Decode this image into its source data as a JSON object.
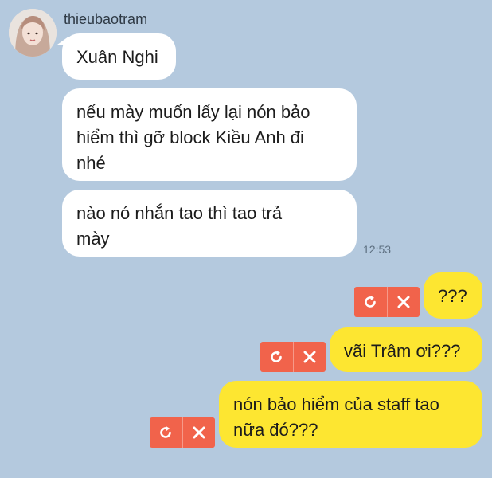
{
  "chat": {
    "sender_name": "thieubaotram",
    "incoming": [
      {
        "text": "Xuân Nghi"
      },
      {
        "text": "nếu mày muốn lấy lại nón bảo\nhiểm thì gỡ block Kiều Anh đi\nnhé"
      },
      {
        "text": "nào nó nhắn tao thì tao trả\nmày"
      }
    ],
    "incoming_time": "12:53",
    "outgoing": [
      {
        "text": "???"
      },
      {
        "text": "vãi Trâm ơi???"
      },
      {
        "text": "nón bảo hiểm của staff tao\nnữa đó???"
      }
    ],
    "retry_glyph": "⟳",
    "delete_glyph": "✕"
  },
  "colors": {
    "background": "#b4c9de",
    "incoming_bubble": "#ffffff",
    "outgoing_bubble": "#fde631",
    "failed_actions": "#f1634b"
  },
  "icons": {
    "avatar": "profile-photo",
    "retry": "retry-icon",
    "delete": "close-icon"
  }
}
